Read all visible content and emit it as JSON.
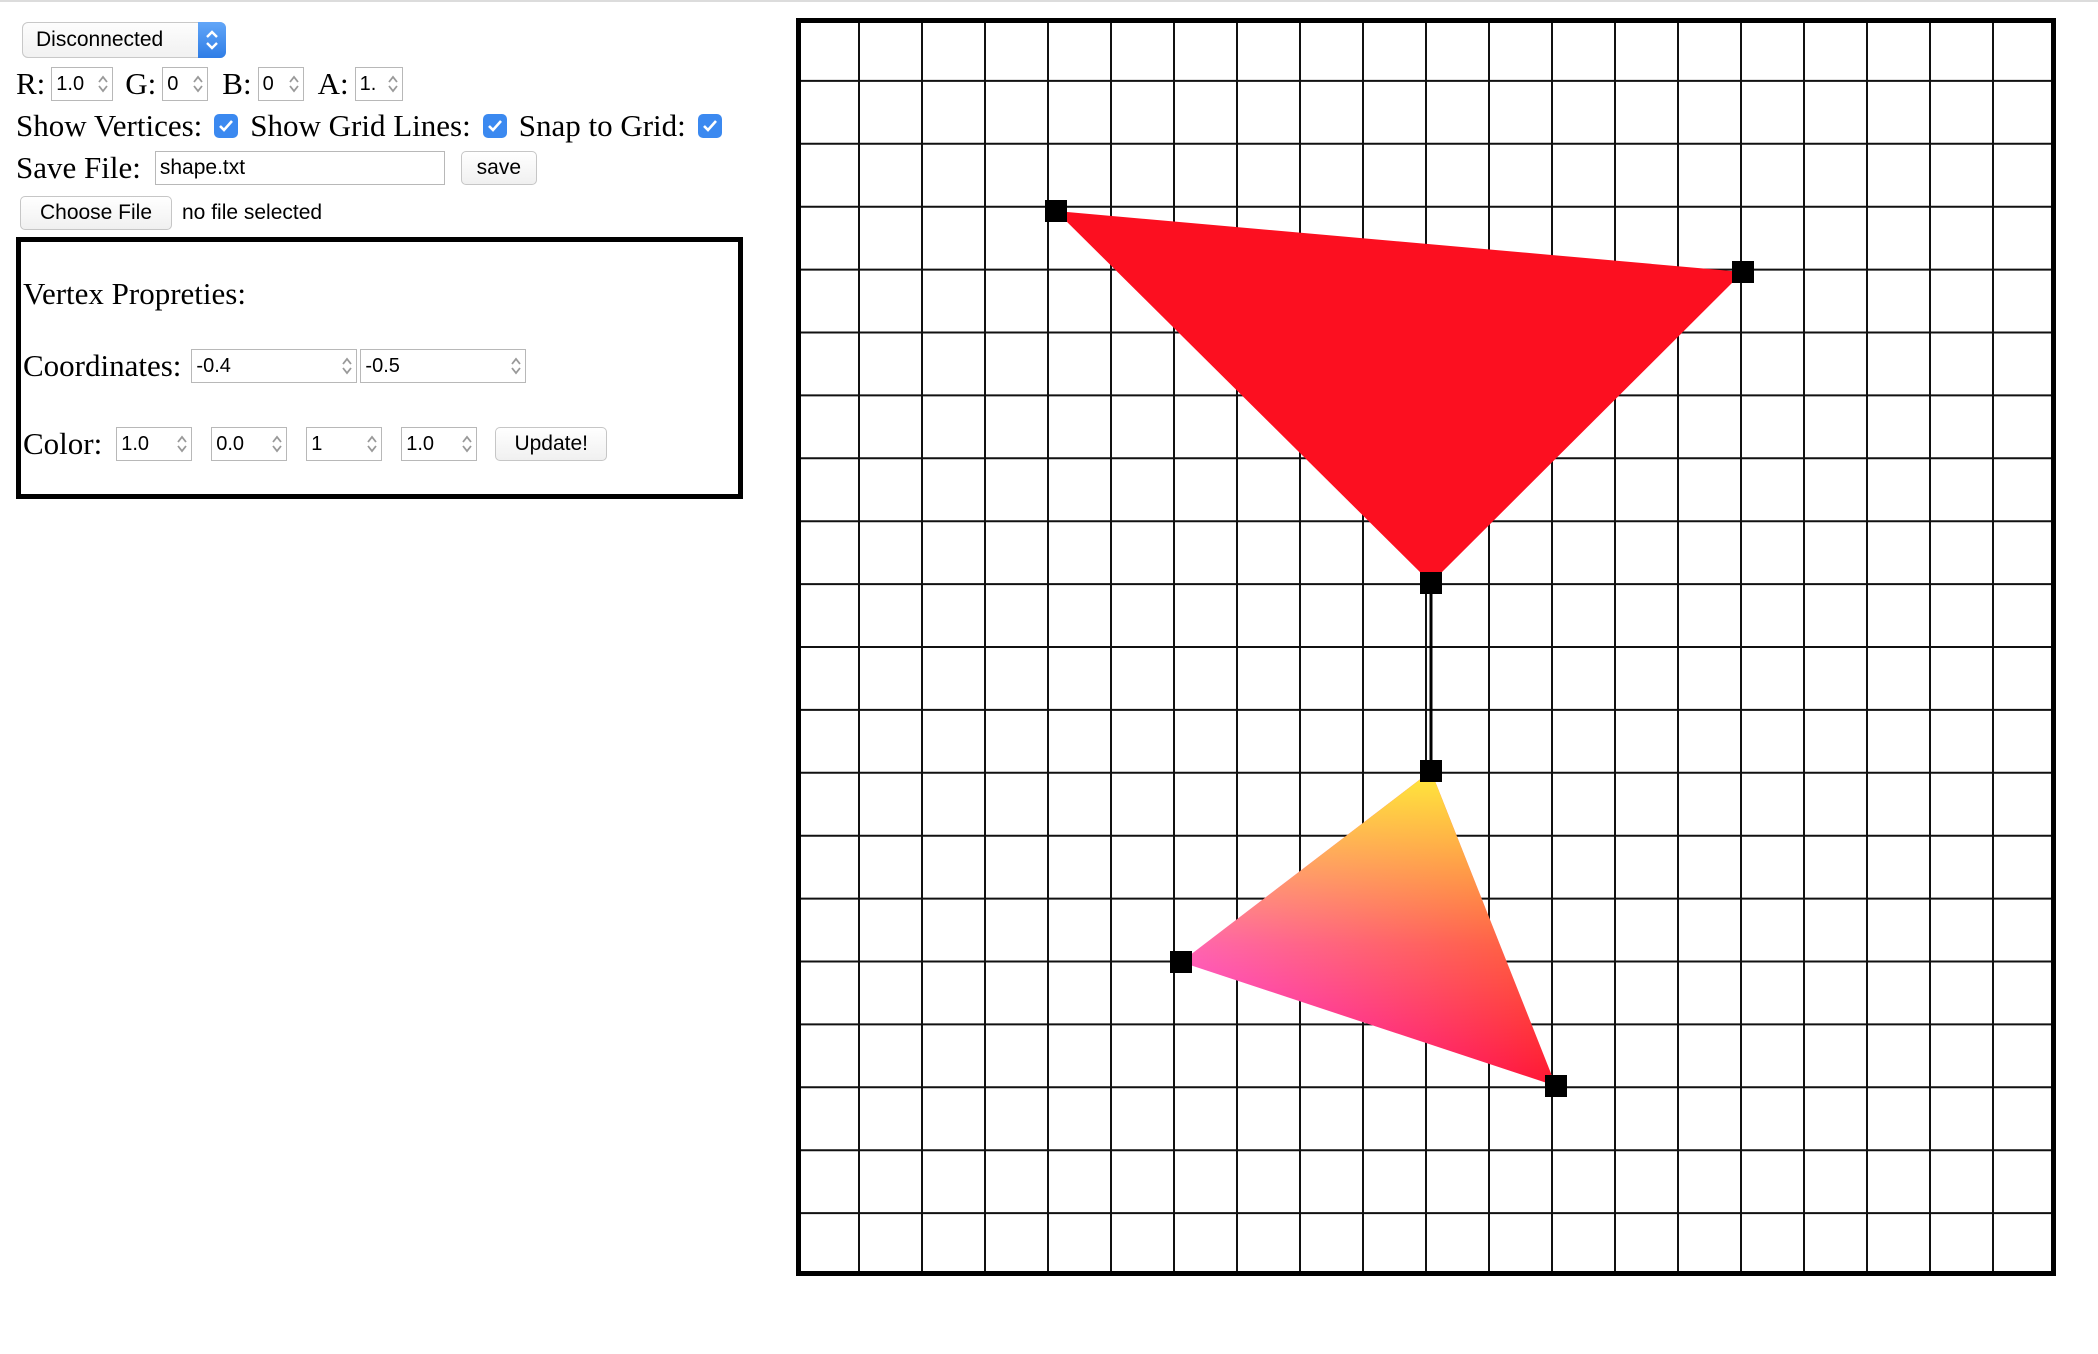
{
  "connection": {
    "selected": "Disconnected"
  },
  "color_inputs": {
    "r_label": "R:",
    "r_value": "1.0",
    "g_label": "G:",
    "g_value": "0",
    "b_label": "B:",
    "b_value": "0",
    "a_label": "A:",
    "a_value": "1."
  },
  "toggles": {
    "show_vertices_label": "Show Vertices:",
    "show_grid_label": "Show Grid Lines:",
    "snap_label": "Snap to Grid:"
  },
  "save": {
    "label": "Save File:",
    "filename": "shape.txt",
    "button": "save"
  },
  "file_chooser": {
    "button": "Choose File",
    "status": "no file selected"
  },
  "vertex_properties": {
    "title": "Vertex Propreties:",
    "coord_label": "Coordinates:",
    "x": "-0.4",
    "y": "-0.5",
    "color_label": "Color:",
    "c1": "1.0",
    "c2": "0.0",
    "c3": "1",
    "c4": "1.0",
    "update_button": "Update!"
  },
  "colors": {
    "accent": "#3b89f0",
    "fill_red": "#fc0f20",
    "grad_yellow": "#ffea3a",
    "grad_magenta": "#ff20f0",
    "grad_red": "#ff1630"
  }
}
